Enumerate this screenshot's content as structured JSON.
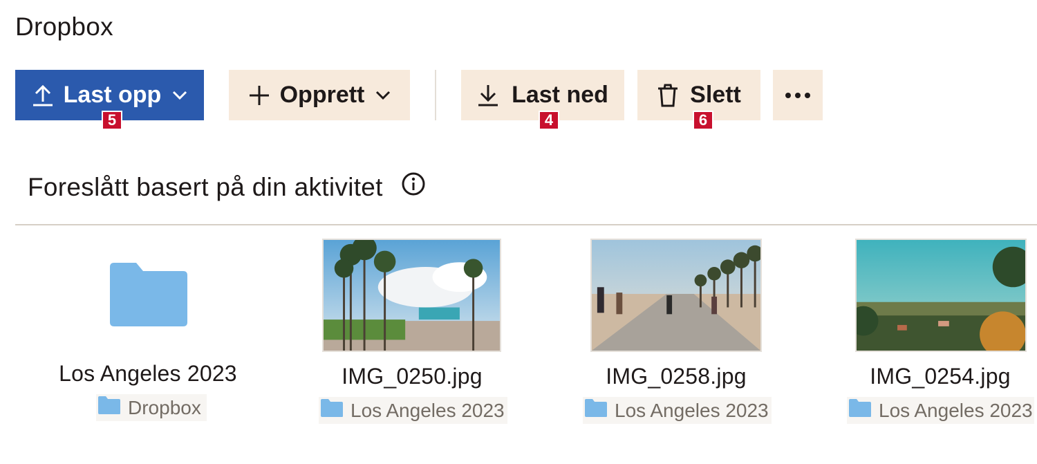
{
  "app": {
    "title": "Dropbox"
  },
  "toolbar": {
    "upload_label": "Last opp",
    "create_label": "Opprett",
    "download_label": "Last ned",
    "delete_label": "Slett",
    "upload_badge": "5",
    "download_badge": "4",
    "delete_badge": "6"
  },
  "suggested": {
    "title": "Foreslått basert på din aktivitet",
    "items": [
      {
        "name": "Los Angeles 2023",
        "location": "Dropbox",
        "type": "folder"
      },
      {
        "name": "IMG_0250.jpg",
        "location": "Los Angeles 2023",
        "type": "image"
      },
      {
        "name": "IMG_0258.jpg",
        "location": "Los Angeles 2023",
        "type": "image"
      },
      {
        "name": "IMG_0254.jpg",
        "location": "Los Angeles 2023",
        "type": "image"
      }
    ]
  },
  "colors": {
    "primary": "#2b5aad",
    "secondary_bg": "#f7eadc",
    "folder": "#7ab8e8",
    "badge": "#c8102e"
  },
  "icons": {
    "upload": "upload-arrow-icon",
    "create": "plus-icon",
    "download": "download-arrow-icon",
    "delete": "trash-icon",
    "more": "more-dots-icon",
    "info": "info-icon",
    "folder": "folder-icon"
  }
}
